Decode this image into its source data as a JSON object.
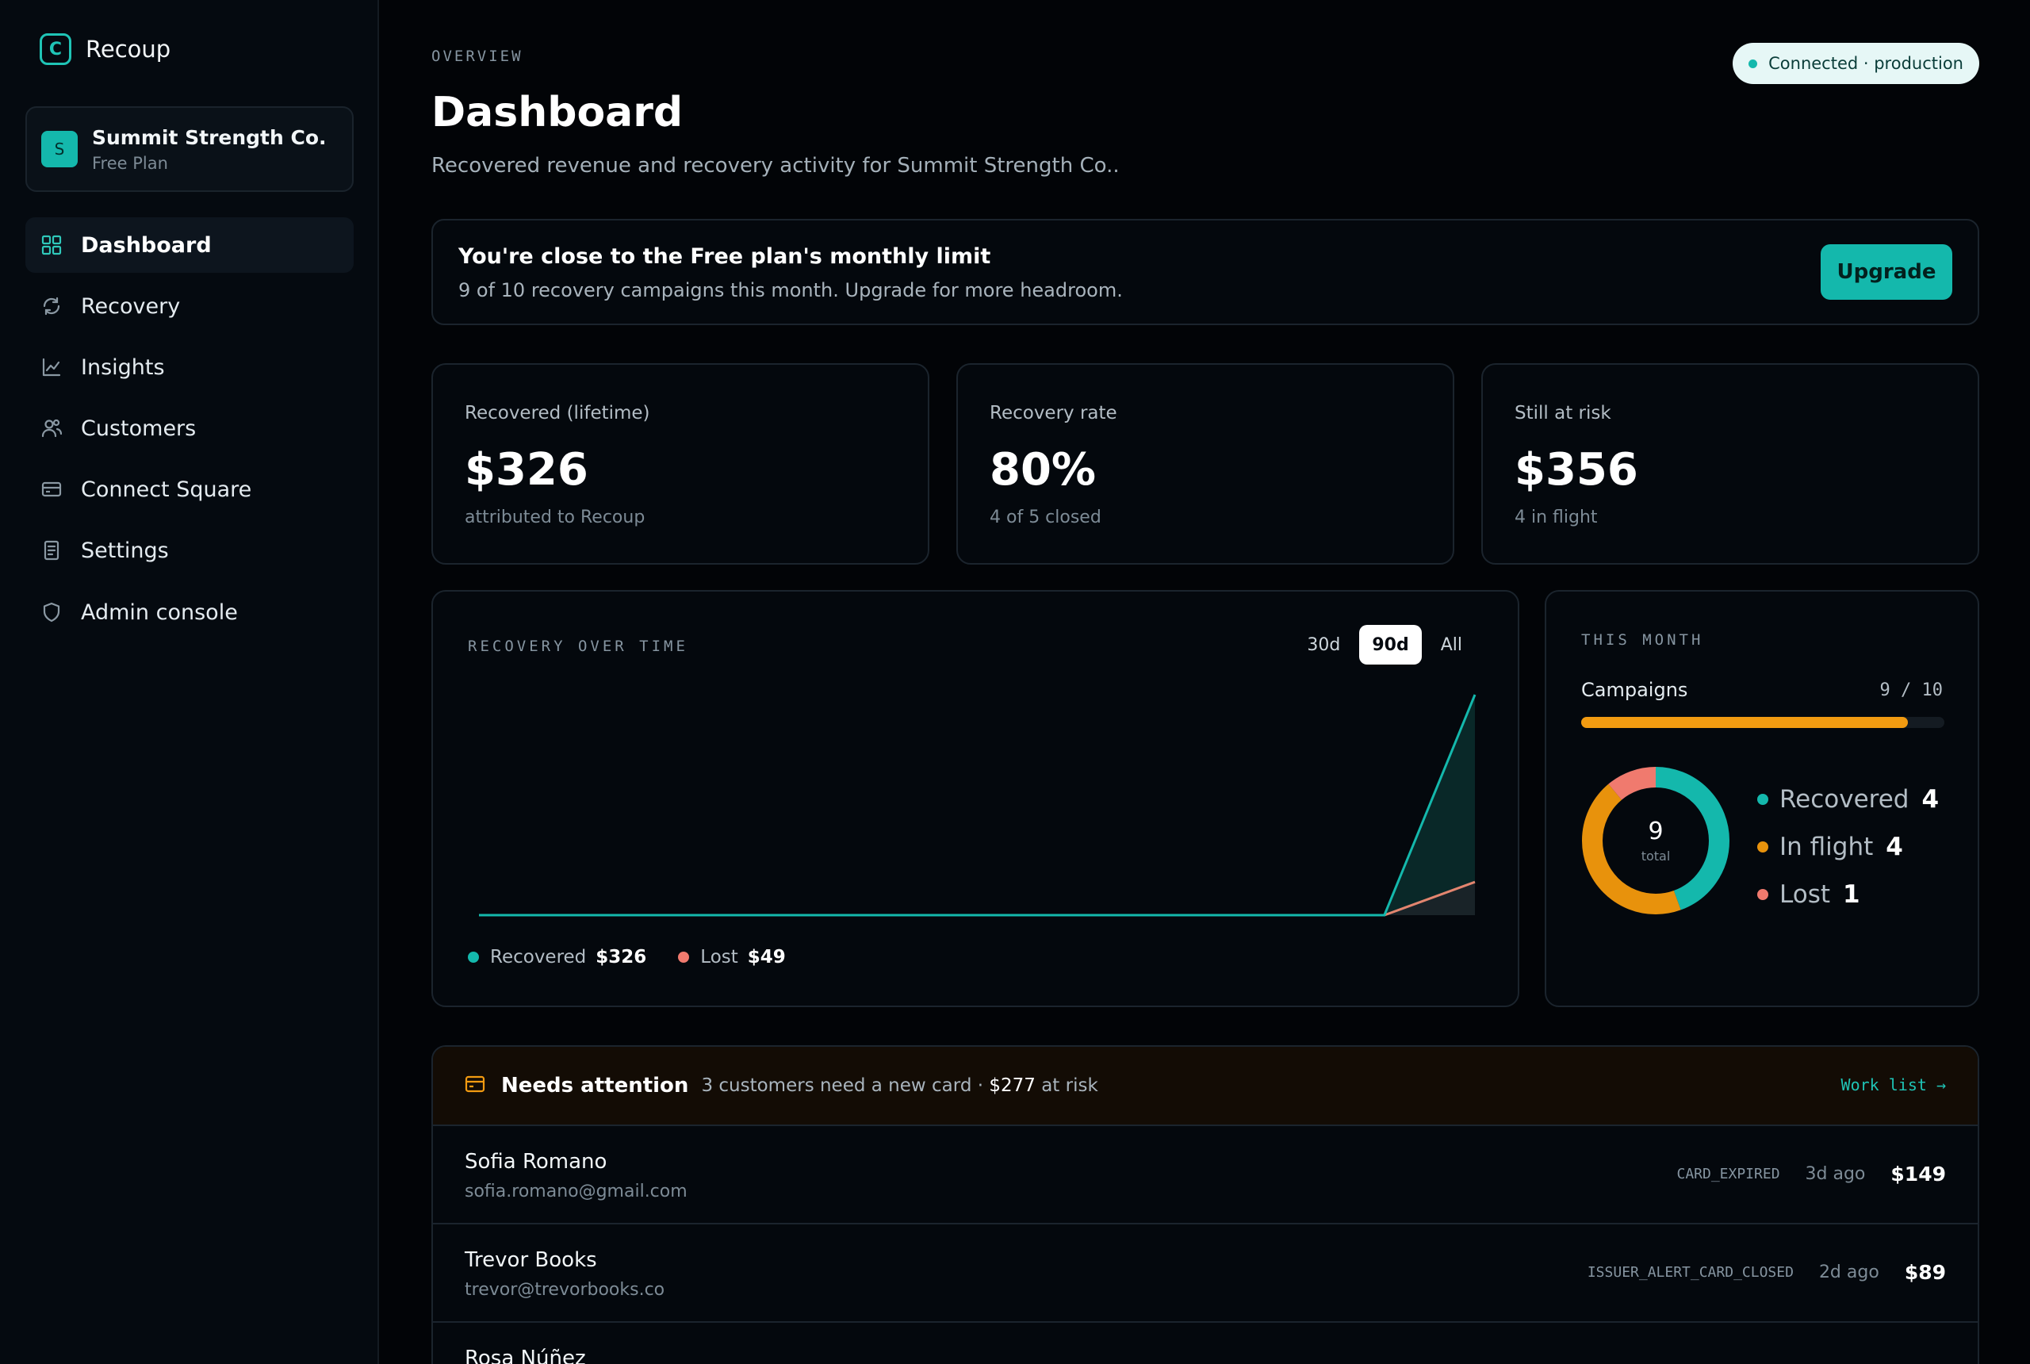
{
  "app": {
    "name": "Recoup"
  },
  "org": {
    "initial": "S",
    "name": "Summit Strength Co.",
    "plan": "Free Plan"
  },
  "nav": [
    {
      "label": "Dashboard",
      "icon": "grid-icon"
    },
    {
      "label": "Recovery",
      "icon": "refresh-icon"
    },
    {
      "label": "Insights",
      "icon": "chart-icon"
    },
    {
      "label": "Customers",
      "icon": "users-icon"
    },
    {
      "label": "Connect Square",
      "icon": "card-icon"
    },
    {
      "label": "Settings",
      "icon": "document-icon"
    },
    {
      "label": "Admin console",
      "icon": "shield-icon"
    }
  ],
  "header": {
    "eyebrow": "OVERVIEW",
    "title": "Dashboard",
    "subtitle": "Recovered revenue and recovery activity for Summit Strength Co..",
    "connection": "Connected · production"
  },
  "limit": {
    "title": "You're close to the Free plan's monthly limit",
    "desc": "9 of 10 recovery campaigns this month. Upgrade for more headroom.",
    "button": "Upgrade"
  },
  "stats": [
    {
      "label": "Recovered (lifetime)",
      "value": "$326",
      "foot": "attributed to Recoup"
    },
    {
      "label": "Recovery rate",
      "value": "80%",
      "foot": "4 of 5 closed"
    },
    {
      "label": "Still at risk",
      "value": "$356",
      "foot": "4 in flight"
    }
  ],
  "chart": {
    "eyebrow": "RECOVERY OVER TIME",
    "ranges": [
      "30d",
      "90d",
      "All"
    ],
    "active_range": "90d",
    "legend": [
      {
        "name": "Recovered",
        "value": "$326",
        "color": "#14b8ac"
      },
      {
        "name": "Lost",
        "value": "$49",
        "color": "#f07a6e"
      }
    ]
  },
  "chart_data": {
    "type": "area",
    "x": [
      0,
      1,
      2,
      3,
      4,
      5,
      6,
      7,
      8,
      9,
      10,
      11
    ],
    "series": [
      {
        "name": "Recovered",
        "values": [
          0,
          0,
          0,
          0,
          0,
          0,
          0,
          0,
          0,
          0,
          0,
          326
        ]
      },
      {
        "name": "Lost",
        "values": [
          0,
          0,
          0,
          0,
          0,
          0,
          0,
          0,
          0,
          0,
          0,
          49
        ]
      }
    ],
    "ylim": [
      0,
      326
    ],
    "grid": false
  },
  "month": {
    "eyebrow": "THIS MONTH",
    "campaigns_label": "Campaigns",
    "campaigns_count": "9 / 10",
    "campaigns_used": 9,
    "campaigns_limit": 10,
    "total": "9",
    "total_caption": "total",
    "breakdown": [
      {
        "name": "Recovered",
        "value": "4",
        "count": 4,
        "color": "#14b8ac"
      },
      {
        "name": "In flight",
        "value": "4",
        "count": 4,
        "color": "#e8920c"
      },
      {
        "name": "Lost",
        "value": "1",
        "count": 1,
        "color": "#f07a6e"
      }
    ]
  },
  "attention": {
    "title": "Needs attention",
    "desc": "3 customers need a new card · ",
    "risk": "$277",
    "risk_suffix": " at risk",
    "link": "Work list →",
    "rows": [
      {
        "name": "Sofia Romano",
        "email": "sofia.romano@gmail.com",
        "code": "CARD_EXPIRED",
        "ago": "3d ago",
        "amount": "$149"
      },
      {
        "name": "Trevor Books",
        "email": "trevor@trevorbooks.co",
        "code": "ISSUER_ALERT_CARD_CLOSED",
        "ago": "2d ago",
        "amount": "$89"
      },
      {
        "name": "Rosa Núñez",
        "email": "",
        "code": "",
        "ago": "",
        "amount": ""
      }
    ]
  }
}
